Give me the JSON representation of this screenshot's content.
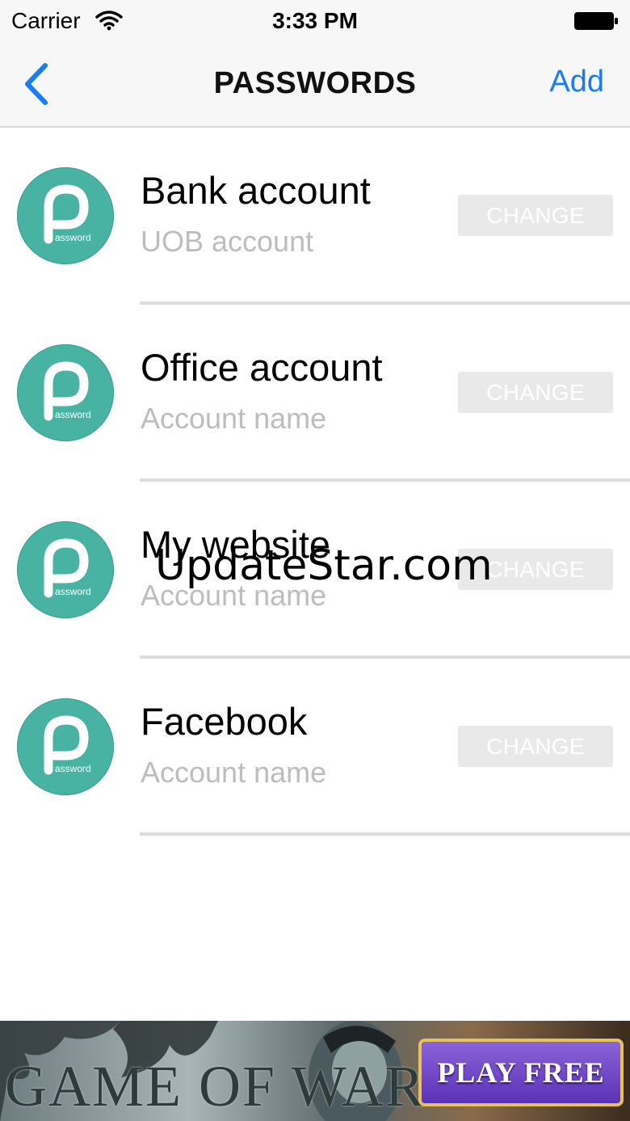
{
  "status_bar": {
    "carrier": "Carrier",
    "time": "3:33 PM",
    "icons": [
      "wifi-icon",
      "battery-icon"
    ]
  },
  "nav": {
    "back_icon": "chevron-left-icon",
    "title": "PASSWORDS",
    "add_label": "Add"
  },
  "logo_text": "assword",
  "accounts": [
    {
      "title": "Bank account",
      "subtitle": "UOB account",
      "button": "CHANGE"
    },
    {
      "title": "Office account",
      "subtitle": "Account name",
      "button": "CHANGE"
    },
    {
      "title": "My website",
      "subtitle": "Account name",
      "button": "CHANGE"
    },
    {
      "title": "Facebook",
      "subtitle": "Account name",
      "button": "CHANGE"
    }
  ],
  "watermark": "UpdateStar.com",
  "ad": {
    "game_title": "GAME OF WAR",
    "cta": "PLAY FREE"
  },
  "colors": {
    "accent": "#1a7cf2",
    "logo": "#48b3a3",
    "button_bg": "#e9e9e9",
    "subtitle": "#bdbdbd"
  }
}
